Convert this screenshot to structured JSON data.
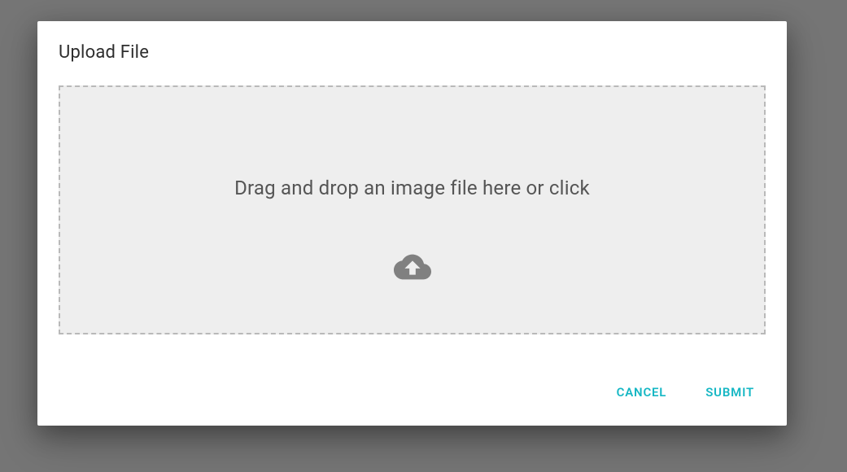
{
  "dialog": {
    "title": "Upload File",
    "dropzone_text": "Drag and drop an image file here or click",
    "cancel_label": "CANCEL",
    "submit_label": "SUBMIT"
  },
  "colors": {
    "accent": "#16b7c4",
    "background": "#757575",
    "dropzone_bg": "#eeeeee",
    "dropzone_border": "#b9b9b9"
  }
}
